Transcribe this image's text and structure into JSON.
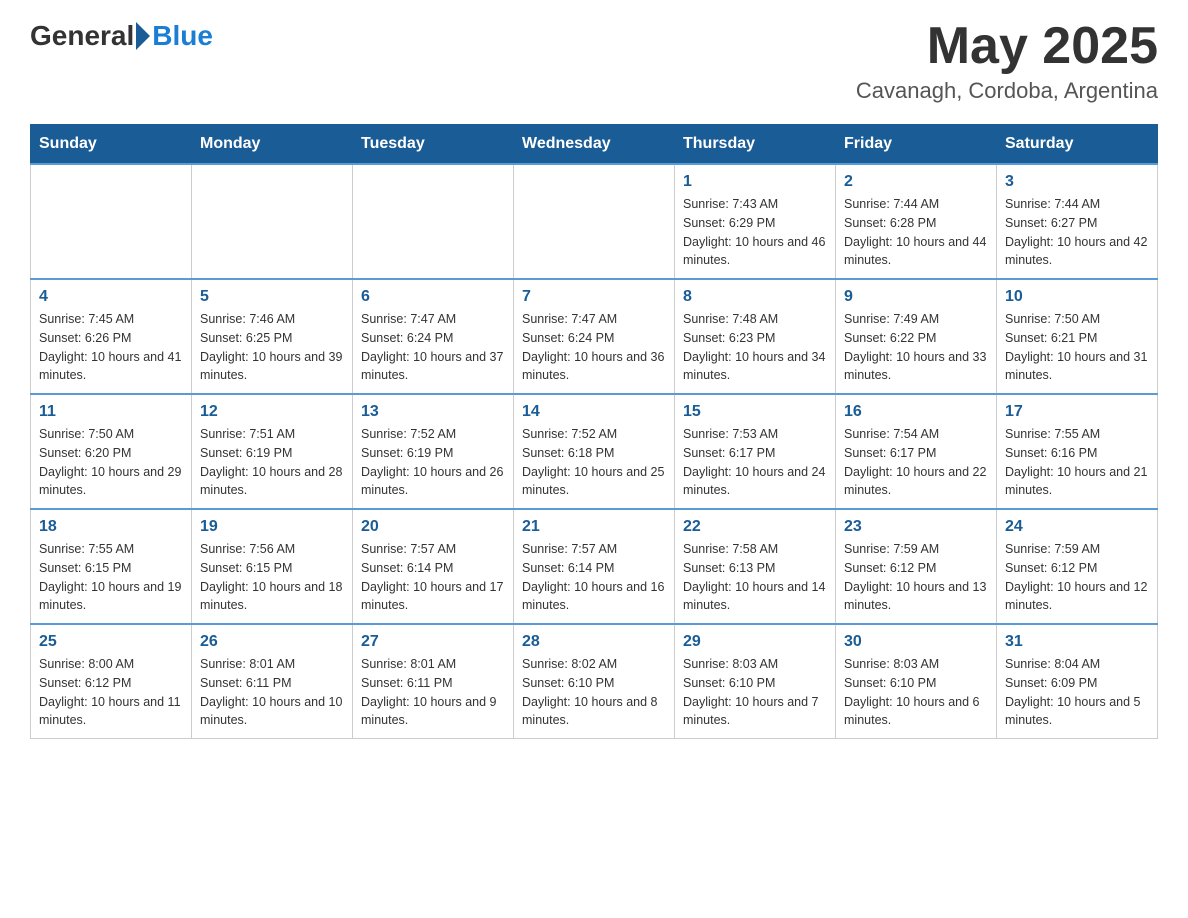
{
  "header": {
    "logo_general": "General",
    "logo_blue": "Blue",
    "month_title": "May 2025",
    "location": "Cavanagh, Cordoba, Argentina"
  },
  "days_of_week": [
    "Sunday",
    "Monday",
    "Tuesday",
    "Wednesday",
    "Thursday",
    "Friday",
    "Saturday"
  ],
  "weeks": [
    [
      {
        "day": "",
        "sunrise": "",
        "sunset": "",
        "daylight": ""
      },
      {
        "day": "",
        "sunrise": "",
        "sunset": "",
        "daylight": ""
      },
      {
        "day": "",
        "sunrise": "",
        "sunset": "",
        "daylight": ""
      },
      {
        "day": "",
        "sunrise": "",
        "sunset": "",
        "daylight": ""
      },
      {
        "day": "1",
        "sunrise": "Sunrise: 7:43 AM",
        "sunset": "Sunset: 6:29 PM",
        "daylight": "Daylight: 10 hours and 46 minutes."
      },
      {
        "day": "2",
        "sunrise": "Sunrise: 7:44 AM",
        "sunset": "Sunset: 6:28 PM",
        "daylight": "Daylight: 10 hours and 44 minutes."
      },
      {
        "day": "3",
        "sunrise": "Sunrise: 7:44 AM",
        "sunset": "Sunset: 6:27 PM",
        "daylight": "Daylight: 10 hours and 42 minutes."
      }
    ],
    [
      {
        "day": "4",
        "sunrise": "Sunrise: 7:45 AM",
        "sunset": "Sunset: 6:26 PM",
        "daylight": "Daylight: 10 hours and 41 minutes."
      },
      {
        "day": "5",
        "sunrise": "Sunrise: 7:46 AM",
        "sunset": "Sunset: 6:25 PM",
        "daylight": "Daylight: 10 hours and 39 minutes."
      },
      {
        "day": "6",
        "sunrise": "Sunrise: 7:47 AM",
        "sunset": "Sunset: 6:24 PM",
        "daylight": "Daylight: 10 hours and 37 minutes."
      },
      {
        "day": "7",
        "sunrise": "Sunrise: 7:47 AM",
        "sunset": "Sunset: 6:24 PM",
        "daylight": "Daylight: 10 hours and 36 minutes."
      },
      {
        "day": "8",
        "sunrise": "Sunrise: 7:48 AM",
        "sunset": "Sunset: 6:23 PM",
        "daylight": "Daylight: 10 hours and 34 minutes."
      },
      {
        "day": "9",
        "sunrise": "Sunrise: 7:49 AM",
        "sunset": "Sunset: 6:22 PM",
        "daylight": "Daylight: 10 hours and 33 minutes."
      },
      {
        "day": "10",
        "sunrise": "Sunrise: 7:50 AM",
        "sunset": "Sunset: 6:21 PM",
        "daylight": "Daylight: 10 hours and 31 minutes."
      }
    ],
    [
      {
        "day": "11",
        "sunrise": "Sunrise: 7:50 AM",
        "sunset": "Sunset: 6:20 PM",
        "daylight": "Daylight: 10 hours and 29 minutes."
      },
      {
        "day": "12",
        "sunrise": "Sunrise: 7:51 AM",
        "sunset": "Sunset: 6:19 PM",
        "daylight": "Daylight: 10 hours and 28 minutes."
      },
      {
        "day": "13",
        "sunrise": "Sunrise: 7:52 AM",
        "sunset": "Sunset: 6:19 PM",
        "daylight": "Daylight: 10 hours and 26 minutes."
      },
      {
        "day": "14",
        "sunrise": "Sunrise: 7:52 AM",
        "sunset": "Sunset: 6:18 PM",
        "daylight": "Daylight: 10 hours and 25 minutes."
      },
      {
        "day": "15",
        "sunrise": "Sunrise: 7:53 AM",
        "sunset": "Sunset: 6:17 PM",
        "daylight": "Daylight: 10 hours and 24 minutes."
      },
      {
        "day": "16",
        "sunrise": "Sunrise: 7:54 AM",
        "sunset": "Sunset: 6:17 PM",
        "daylight": "Daylight: 10 hours and 22 minutes."
      },
      {
        "day": "17",
        "sunrise": "Sunrise: 7:55 AM",
        "sunset": "Sunset: 6:16 PM",
        "daylight": "Daylight: 10 hours and 21 minutes."
      }
    ],
    [
      {
        "day": "18",
        "sunrise": "Sunrise: 7:55 AM",
        "sunset": "Sunset: 6:15 PM",
        "daylight": "Daylight: 10 hours and 19 minutes."
      },
      {
        "day": "19",
        "sunrise": "Sunrise: 7:56 AM",
        "sunset": "Sunset: 6:15 PM",
        "daylight": "Daylight: 10 hours and 18 minutes."
      },
      {
        "day": "20",
        "sunrise": "Sunrise: 7:57 AM",
        "sunset": "Sunset: 6:14 PM",
        "daylight": "Daylight: 10 hours and 17 minutes."
      },
      {
        "day": "21",
        "sunrise": "Sunrise: 7:57 AM",
        "sunset": "Sunset: 6:14 PM",
        "daylight": "Daylight: 10 hours and 16 minutes."
      },
      {
        "day": "22",
        "sunrise": "Sunrise: 7:58 AM",
        "sunset": "Sunset: 6:13 PM",
        "daylight": "Daylight: 10 hours and 14 minutes."
      },
      {
        "day": "23",
        "sunrise": "Sunrise: 7:59 AM",
        "sunset": "Sunset: 6:12 PM",
        "daylight": "Daylight: 10 hours and 13 minutes."
      },
      {
        "day": "24",
        "sunrise": "Sunrise: 7:59 AM",
        "sunset": "Sunset: 6:12 PM",
        "daylight": "Daylight: 10 hours and 12 minutes."
      }
    ],
    [
      {
        "day": "25",
        "sunrise": "Sunrise: 8:00 AM",
        "sunset": "Sunset: 6:12 PM",
        "daylight": "Daylight: 10 hours and 11 minutes."
      },
      {
        "day": "26",
        "sunrise": "Sunrise: 8:01 AM",
        "sunset": "Sunset: 6:11 PM",
        "daylight": "Daylight: 10 hours and 10 minutes."
      },
      {
        "day": "27",
        "sunrise": "Sunrise: 8:01 AM",
        "sunset": "Sunset: 6:11 PM",
        "daylight": "Daylight: 10 hours and 9 minutes."
      },
      {
        "day": "28",
        "sunrise": "Sunrise: 8:02 AM",
        "sunset": "Sunset: 6:10 PM",
        "daylight": "Daylight: 10 hours and 8 minutes."
      },
      {
        "day": "29",
        "sunrise": "Sunrise: 8:03 AM",
        "sunset": "Sunset: 6:10 PM",
        "daylight": "Daylight: 10 hours and 7 minutes."
      },
      {
        "day": "30",
        "sunrise": "Sunrise: 8:03 AM",
        "sunset": "Sunset: 6:10 PM",
        "daylight": "Daylight: 10 hours and 6 minutes."
      },
      {
        "day": "31",
        "sunrise": "Sunrise: 8:04 AM",
        "sunset": "Sunset: 6:09 PM",
        "daylight": "Daylight: 10 hours and 5 minutes."
      }
    ]
  ]
}
